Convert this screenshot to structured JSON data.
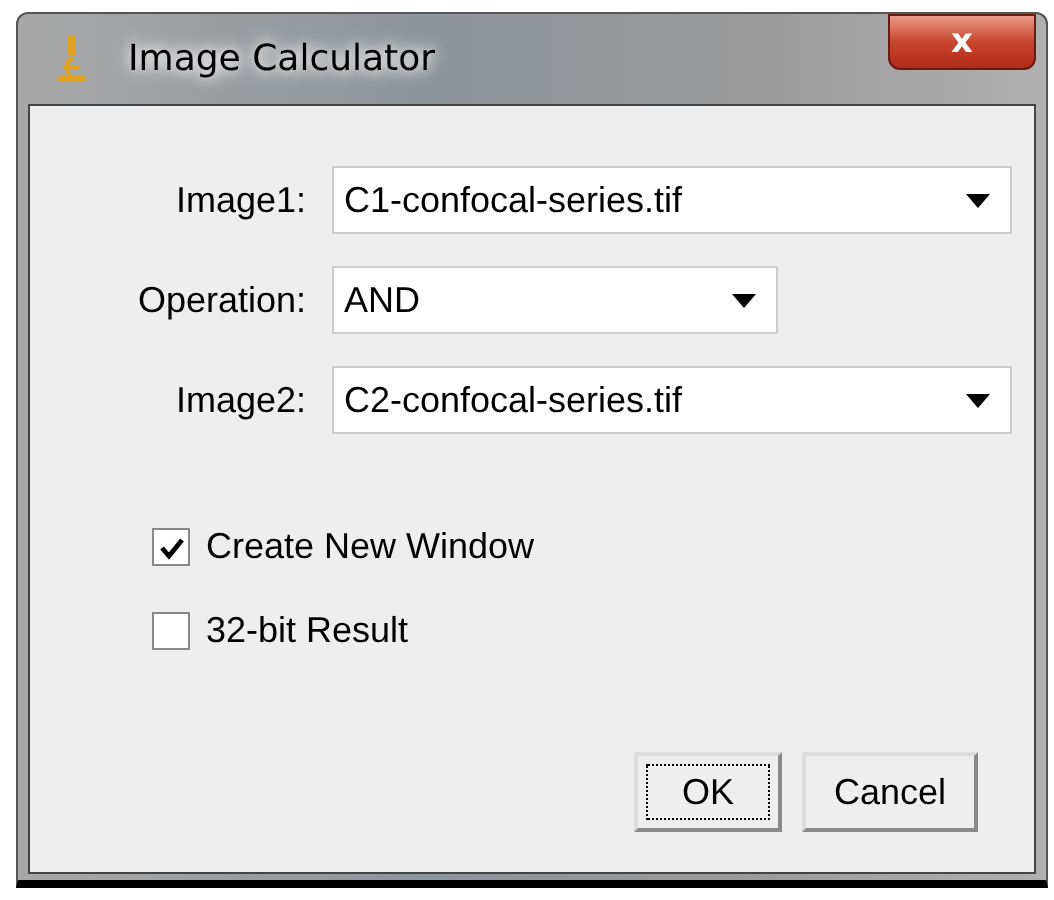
{
  "window": {
    "title": "Image Calculator",
    "close": "x"
  },
  "fields": [
    {
      "label": "Image1:",
      "value": "C1-confocal-series.tif",
      "kind": "wide"
    },
    {
      "label": "Operation:",
      "value": "AND",
      "kind": "narrow"
    },
    {
      "label": "Image2:",
      "value": "C2-confocal-series.tif",
      "kind": "wide"
    }
  ],
  "checkboxes": [
    {
      "label": "Create New Window",
      "checked": true
    },
    {
      "label": "32-bit Result",
      "checked": false
    }
  ],
  "buttons": [
    {
      "label": "OK",
      "focused": true
    },
    {
      "label": "Cancel",
      "focused": false
    }
  ]
}
